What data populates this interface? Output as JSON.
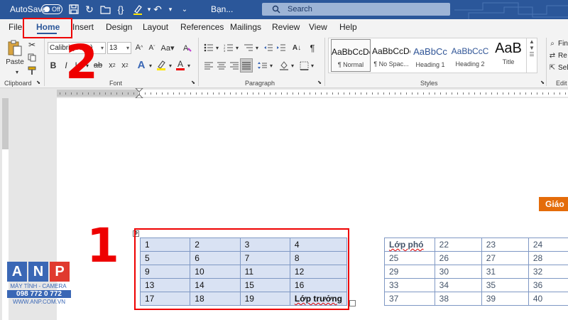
{
  "titlebar": {
    "autosave_label": "AutoSave",
    "autosave_state": "Off",
    "doc_name": "Bạn...",
    "search_placeholder": "Search"
  },
  "tabs": [
    {
      "label": "File"
    },
    {
      "label": "Home",
      "active": true
    },
    {
      "label": "Insert"
    },
    {
      "label": "Design"
    },
    {
      "label": "Layout"
    },
    {
      "label": "References"
    },
    {
      "label": "Mailings"
    },
    {
      "label": "Review"
    },
    {
      "label": "View"
    },
    {
      "label": "Help"
    }
  ],
  "ribbon": {
    "clipboard": {
      "paste_label": "Paste",
      "group_label": "Clipboard"
    },
    "font": {
      "font_name": "Calibri (Body)",
      "font_size": "13",
      "group_label": "Font"
    },
    "paragraph": {
      "group_label": "Paragraph"
    },
    "styles": {
      "group_label": "Styles",
      "items": [
        {
          "sample": "AaBbCcDc",
          "name": "¶ Normal"
        },
        {
          "sample": "AaBbCcDc",
          "name": "¶ No Spac..."
        },
        {
          "sample": "AaBbCc",
          "name": "Heading 1"
        },
        {
          "sample": "AaBbCcC",
          "name": "Heading 2"
        },
        {
          "sample": "AaB",
          "name": "Title"
        }
      ]
    },
    "editing": {
      "find": "Fin",
      "replace": "Re",
      "select": "Sel",
      "group_label": "Edit"
    }
  },
  "document": {
    "header_cell": "Giáo",
    "table1": [
      [
        "1",
        "2",
        "3",
        "4"
      ],
      [
        "5",
        "6",
        "7",
        "8"
      ],
      [
        "9",
        "10",
        "11",
        "12"
      ],
      [
        "13",
        "14",
        "15",
        "16"
      ],
      [
        "17",
        "18",
        "19",
        "Lớp trưởng"
      ]
    ],
    "table2": [
      [
        "Lớp phó",
        "22",
        "23",
        "24"
      ],
      [
        "25",
        "26",
        "27",
        "28"
      ],
      [
        "29",
        "30",
        "31",
        "32"
      ],
      [
        "33",
        "34",
        "35",
        "36"
      ],
      [
        "37",
        "38",
        "39",
        "40"
      ]
    ]
  },
  "annotations": {
    "step1": "1",
    "step2": "2",
    "color": "#e00000"
  },
  "watermark": {
    "letters": [
      "A",
      "N",
      "P"
    ],
    "line1": "MÁY TÍNH - CAMERA",
    "phone": "098 772 0 772",
    "website": "WWW.ANP.COM.VN"
  },
  "colors": {
    "titlebar": "#2b579a",
    "table1_fill": "#d9e2f3",
    "table_border": "#7f98c4",
    "orange": "#e46c0a"
  }
}
